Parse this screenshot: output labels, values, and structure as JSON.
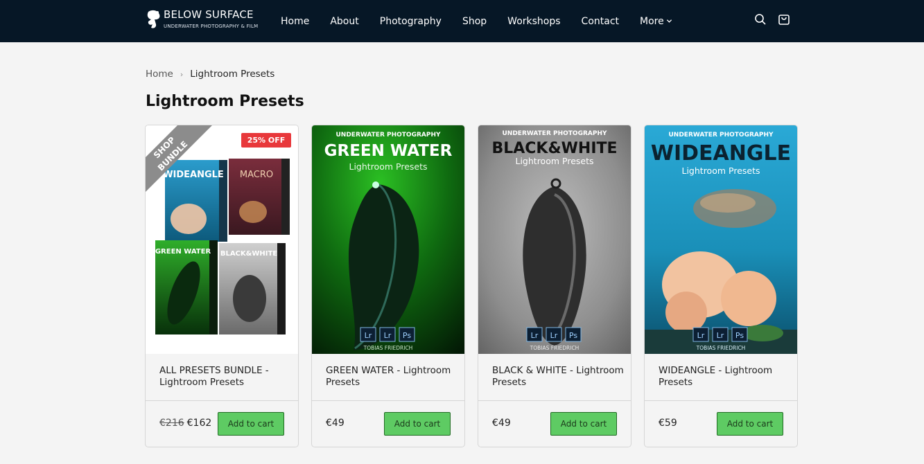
{
  "brand": {
    "name": "BELOW SURFACE",
    "tagline": "UNDERWATER PHOTOGRAPHY & FILM"
  },
  "nav": {
    "items": [
      "Home",
      "About",
      "Photography",
      "Shop",
      "Workshops",
      "Contact"
    ],
    "more_label": "More",
    "search_icon": "search-icon",
    "cart_icon": "shopping-bag-icon"
  },
  "breadcrumb": {
    "home": "Home",
    "separator": "›",
    "current": "Lightroom Presets"
  },
  "page_title": "Lightroom Presets",
  "products": [
    {
      "name": "ALL PRESETS BUNDLE - Lightroom Presets",
      "old_price": "€216",
      "price": "€162",
      "badge": "25% OFF",
      "ribbon_line1": "SHOP",
      "ribbon_line2": "BUNDLE",
      "button": "Add to cart",
      "box_titles": [
        "WIDEANGLE",
        "MACRO",
        "GREEN WATER",
        "BLACK&WHITE"
      ]
    },
    {
      "name": "GREEN WATER - Lightroom Presets",
      "price": "€49",
      "button": "Add to cart",
      "cover": {
        "kicker": "UNDERWATER PHOTOGRAPHY",
        "title": "GREEN WATER",
        "subtitle": "Lightroom Presets",
        "author": "TOBIAS FRIEDRICH"
      }
    },
    {
      "name": "BLACK & WHITE - Lightroom Presets",
      "price": "€49",
      "button": "Add to cart",
      "cover": {
        "kicker": "UNDERWATER PHOTOGRAPHY",
        "title": "BLACK&WHITE",
        "subtitle": "Lightroom Presets",
        "author": "TOBIAS FRIEDRICH"
      }
    },
    {
      "name": "WIDEANGLE - Lightroom Presets",
      "price": "€59",
      "button": "Add to cart",
      "cover": {
        "kicker": "UNDERWATER PHOTOGRAPHY",
        "title": "WIDEANGLE",
        "subtitle": "Lightroom Presets",
        "author": "TOBIAS FRIEDRICH"
      }
    }
  ],
  "software_badges": [
    "Lr",
    "Lr",
    "Ps"
  ],
  "colors": {
    "header_bg": "#061726",
    "page_bg": "#f4f4f4",
    "button_green": "#5ecb63",
    "badge_red": "#e8383b",
    "green_cover": "#0f6a10",
    "bw_cover": "#8e8e8e",
    "wide_cover": "#1a8fb8"
  }
}
